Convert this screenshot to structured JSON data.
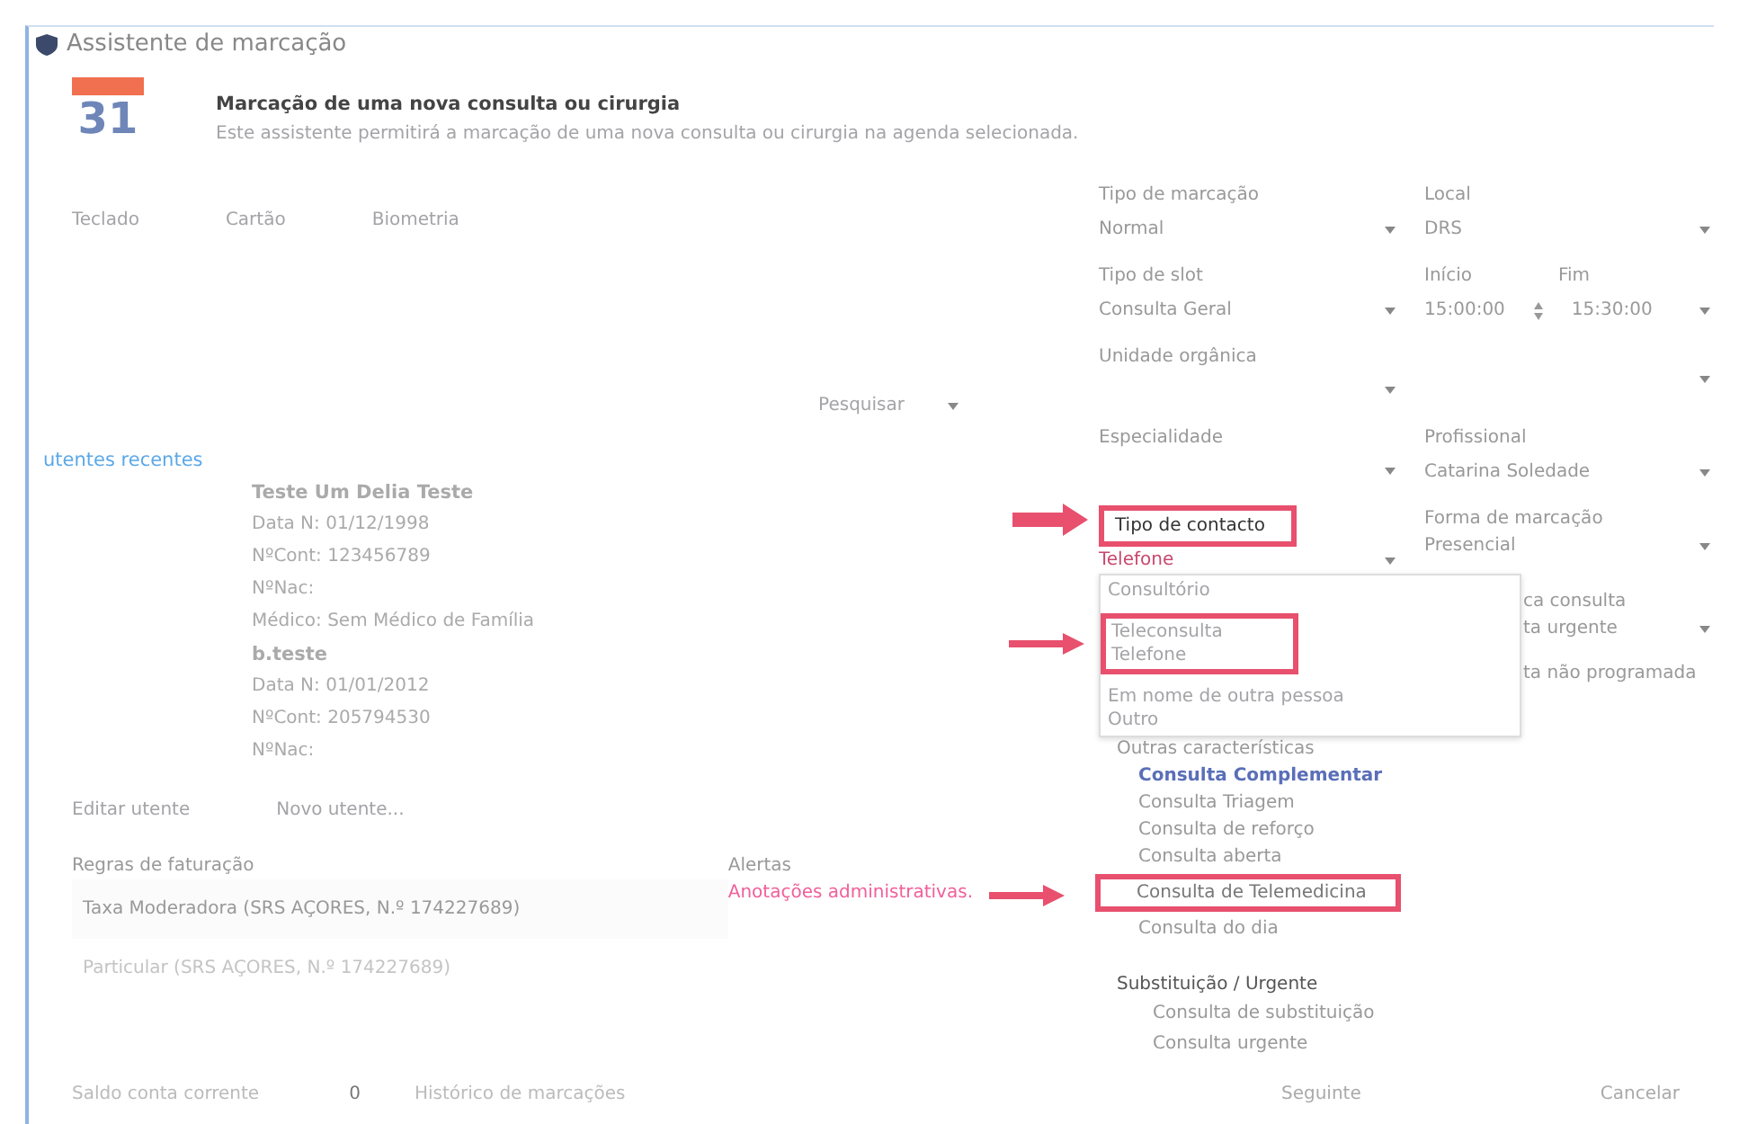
{
  "window": {
    "title": "Assistente de marcação"
  },
  "header": {
    "calendar_day": "31",
    "title": "Marcação de uma nova consulta ou cirurgia",
    "subtitle": "Este assistente permitirá a marcação de uma nova consulta ou cirurgia na agenda selecionada."
  },
  "input_modes": [
    "Teclado",
    "Cartão",
    "Biometria"
  ],
  "search_button": "Pesquisar",
  "recent_label": "utentes recentes",
  "patients": [
    {
      "name": "Teste Um Delia Teste",
      "lines": [
        "Data N: 01/12/1998",
        "NºCont: 123456789",
        "NºNac:",
        "Médico: Sem Médico de Família"
      ]
    },
    {
      "name": "b.teste",
      "lines": [
        "Data N: 01/01/2012",
        "NºCont: 205794530",
        "NºNac:"
      ]
    }
  ],
  "patient_actions": [
    "Editar utente",
    "Novo utente..."
  ],
  "billing": {
    "label": "Regras de faturação",
    "items": [
      {
        "text": "Taxa Moderadora (SRS AÇORES, N.º 174227689)",
        "selected": true
      },
      {
        "text": "Particular (SRS AÇORES, N.º 174227689)",
        "selected": false
      }
    ]
  },
  "alerts": {
    "label": "Alertas",
    "link": "Anotações administrativas."
  },
  "fields": [
    {
      "left": {
        "label": "Tipo de marcação",
        "value": "Normal"
      },
      "right": {
        "label": "Local",
        "value": "DRS"
      }
    },
    {
      "left": {
        "label": "Tipo de slot",
        "value": "Consulta Geral"
      },
      "right": {
        "label": "Início",
        "value": "15:00:00",
        "label2": "Fim",
        "value2": "15:30:00"
      }
    },
    {
      "left": {
        "label": "Unidade orgânica"
      }
    },
    {
      "left": {
        "label": "Especialidade"
      },
      "right": {
        "label": "Profissional",
        "value": "Catarina Soledade"
      }
    }
  ],
  "contact": {
    "label": "Tipo de contacto",
    "highlighted": true,
    "value": "Telefone",
    "right_label": "Forma de marcação",
    "right_value": "Presencial",
    "options": [
      {
        "text": "Consultório",
        "highlighted": false
      },
      {
        "text": "Teleconsulta",
        "highlighted": true
      },
      {
        "text": "Telefone",
        "highlighted": true
      },
      {
        "text": "Em nome de outra pessoa",
        "highlighted": false
      },
      {
        "text": "Outro",
        "highlighted": false
      }
    ],
    "behind_label": "ca consulta",
    "behind_value": "ta urgente",
    "behind_check": "ta não programada"
  },
  "other": {
    "label": "Outras características",
    "items": [
      {
        "text": "Consulta Complementar",
        "selected": true,
        "highlighted": false
      },
      {
        "text": "Consulta Triagem",
        "selected": false,
        "highlighted": false
      },
      {
        "text": "Consulta de reforço",
        "selected": false,
        "highlighted": false
      },
      {
        "text": "Consulta aberta",
        "selected": false,
        "highlighted": false
      },
      {
        "text": "Consulta de Telemedicina",
        "selected": false,
        "highlighted": true
      },
      {
        "text": "Consulta do dia",
        "selected": false,
        "highlighted": false
      }
    ]
  },
  "urgent": {
    "label": "Substituição / Urgente",
    "items": [
      "Consulta de substituição",
      "Consulta urgente"
    ]
  },
  "footer": {
    "balance_label": "Saldo conta corrente",
    "balance": "0",
    "history": "Histórico de marcações",
    "buttons": [
      "Seguinte",
      "Cancelar"
    ]
  }
}
